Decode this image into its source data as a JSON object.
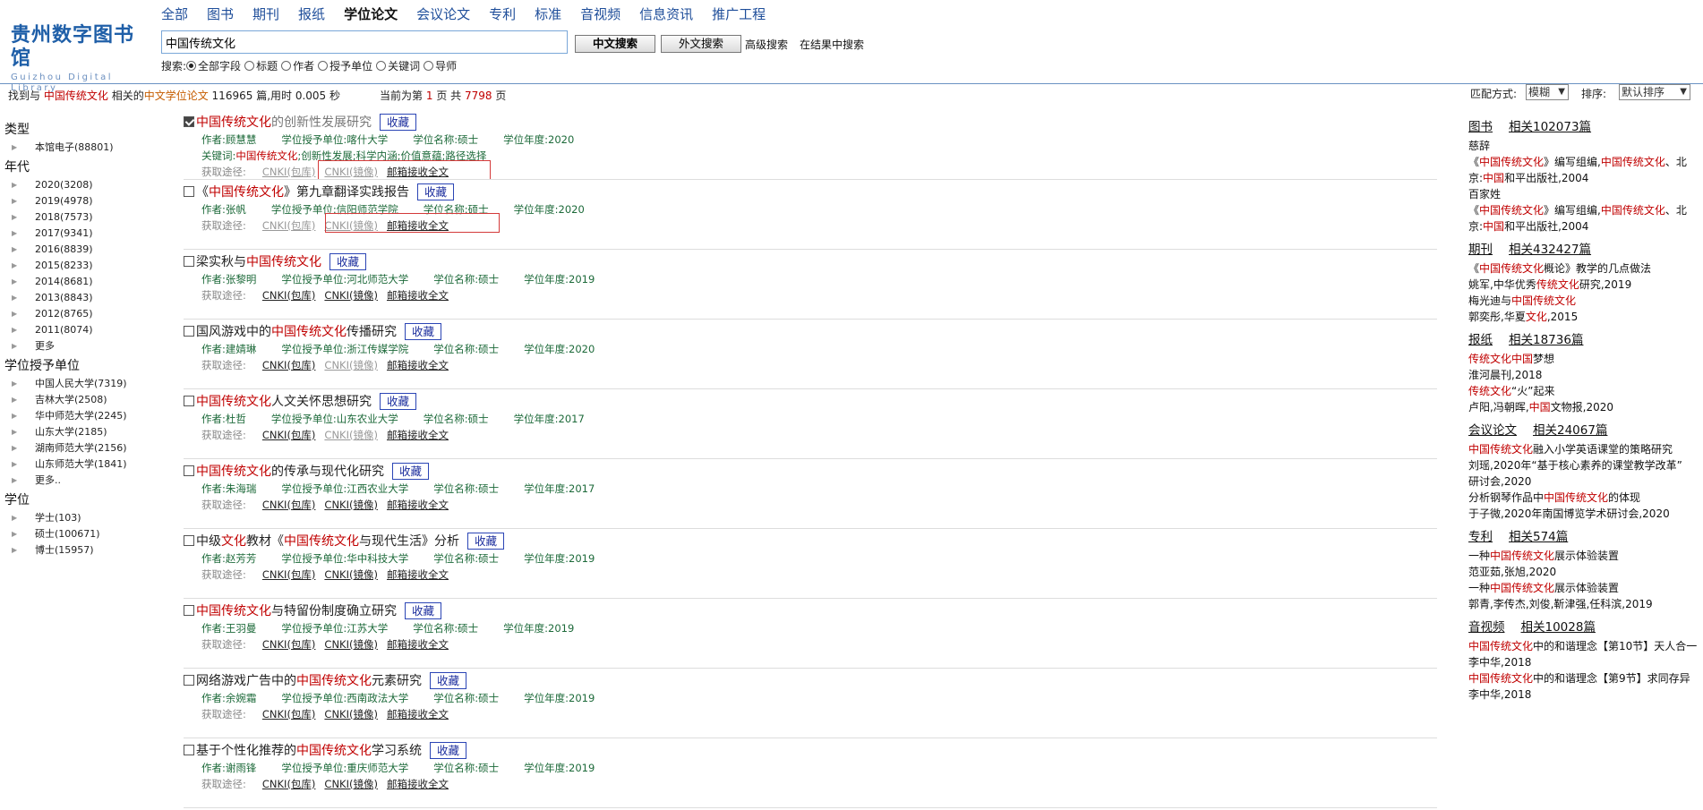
{
  "logo": {
    "cn": "贵州数字图书馆",
    "en": "Guizhou Digital Library"
  },
  "nav": [
    "全部",
    "图书",
    "期刊",
    "报纸",
    "学位论文",
    "会议论文",
    "专利",
    "标准",
    "音视频",
    "信息资讯",
    "推广工程"
  ],
  "nav_active": 4,
  "search": {
    "value": "中国传统文化",
    "btn_cn": "中文搜索",
    "btn_foreign": "外文搜索",
    "advanced": "高级搜索",
    "within": "在结果中搜索"
  },
  "scope": {
    "label": "搜索:",
    "options": [
      "全部字段",
      "标题",
      "作者",
      "授予单位",
      "关键词",
      "导师"
    ],
    "selected": 0
  },
  "summary": {
    "found_prefix": "找到与",
    "query": "中国传统文化",
    "related_prefix": "相关的",
    "type": "中文学位论文",
    "count": "116965",
    "time_text": "篇,用时 0.005 秒"
  },
  "paging": {
    "prefix": "当前为第",
    "current": "1",
    "middle": "页 共",
    "total": "7798",
    "suffix": "页"
  },
  "match": {
    "label": "匹配方式:",
    "value": "模糊"
  },
  "sort": {
    "label": "排序:",
    "value": "默认排序"
  },
  "facets": {
    "type": {
      "title": "类型",
      "items": [
        "本馆电子(88801)"
      ]
    },
    "year": {
      "title": "年代",
      "items": [
        "2020(3208)",
        "2019(4978)",
        "2018(7573)",
        "2017(9341)",
        "2016(8839)",
        "2015(8233)",
        "2014(8681)",
        "2013(8843)",
        "2012(8765)",
        "2011(8074)",
        "更多"
      ]
    },
    "unit": {
      "title": "学位授予单位",
      "items": [
        "中国人民大学(7319)",
        "吉林大学(2508)",
        "华中师范大学(2245)",
        "山东大学(2185)",
        "湖南师范大学(2156)",
        "山东师范大学(1841)",
        "更多.."
      ]
    },
    "degree": {
      "title": "学位",
      "items": [
        "学士(103)",
        "硕士(100671)",
        "博士(15957)"
      ]
    }
  },
  "labels": {
    "author": "作者:",
    "unit": "学位授予单位:",
    "degree": "学位名称:",
    "year": "学位年度:",
    "keywords": "关键词:",
    "access": "获取途径:",
    "collect": "收藏",
    "acc1": "CNKI(包库)",
    "acc2": "CNKI(镜像)",
    "acc3": "邮箱接收全文"
  },
  "results": [
    {
      "title": [
        "中国传统文化",
        "的创新性发展研究"
      ],
      "author": "顾慧慧",
      "unit": "喀什大学",
      "degree": "硕士",
      "year": "2020",
      "keywords": [
        "中国传统文化",
        "创新性发展",
        "科学内涵",
        "价值意蕴",
        "路径选择"
      ]
    },
    {
      "title": [
        "《",
        "中国传统文化",
        "》第九章翻译实践报告"
      ],
      "author": "张帆",
      "unit": "信阳师范学院",
      "degree": "硕士",
      "year": "2020"
    },
    {
      "title": [
        "梁实秋与",
        "中国传统文化"
      ],
      "author": "张黎明",
      "unit": "河北师范大学",
      "degree": "硕士",
      "year": "2019"
    },
    {
      "title": [
        "国风游戏中的",
        "中国传统文化",
        "传播研究"
      ],
      "author": "建婧琳",
      "unit": "浙江传媒学院",
      "degree": "硕士",
      "year": "2020"
    },
    {
      "title": [
        "中国传统文化",
        "人文关怀思想研究"
      ],
      "author": "杜哲",
      "unit": "山东农业大学",
      "degree": "硕士",
      "year": "2017"
    },
    {
      "title": [
        "中国传统文化",
        "的传承与现代化研究"
      ],
      "author": "朱海瑞",
      "unit": "江西农业大学",
      "degree": "硕士",
      "year": "2017"
    },
    {
      "title": [
        "中级",
        "文化",
        "教材《",
        "中国传统文化",
        "与现代生活》分析"
      ],
      "author": "赵芳芳",
      "unit": "华中科技大学",
      "degree": "硕士",
      "year": "2019"
    },
    {
      "title": [
        "中国传统文化",
        "与特留份制度确立研究"
      ],
      "author": "王羽曼",
      "unit": "江苏大学",
      "degree": "硕士",
      "year": "2019"
    },
    {
      "title": [
        "网络游戏广告中的",
        "中国传统文化",
        "元素研究"
      ],
      "author": "余婉霜",
      "unit": "西南政法大学",
      "degree": "硕士",
      "year": "2019"
    },
    {
      "title": [
        "基于个性化推荐的",
        "中国传统文化",
        "学习系统"
      ],
      "author": "谢雨锋",
      "unit": "重庆师范大学",
      "degree": "硕士",
      "year": "2019"
    }
  ],
  "right": [
    {
      "cat": "图书",
      "count": "相关102073篇",
      "lines": [
        [
          [
            "慈辞",
            0
          ]
        ],
        [
          [
            "《",
            0
          ],
          [
            "中国传统文化",
            1
          ],
          [
            "》编写组编,",
            0
          ],
          [
            "中国传统文化",
            1
          ],
          [
            "、北",
            0
          ]
        ],
        [
          [
            "京:",
            0
          ],
          [
            "中国",
            1
          ],
          [
            "和平出版社,2004",
            0
          ]
        ],
        [
          [
            "百家姓",
            0
          ]
        ],
        [
          [
            "《",
            0
          ],
          [
            "中国传统文化",
            1
          ],
          [
            "》编写组编,",
            0
          ],
          [
            "中国传统文化",
            1
          ],
          [
            "、北",
            0
          ]
        ],
        [
          [
            "京:",
            0
          ],
          [
            "中国",
            1
          ],
          [
            "和平出版社,2004",
            0
          ]
        ]
      ]
    },
    {
      "cat": "期刊",
      "count": "相关432427篇",
      "lines": [
        [
          [
            "《",
            0
          ],
          [
            "中国传统文化",
            1
          ],
          [
            "概论》教学的几点做法",
            0
          ]
        ],
        [
          [
            "姚军,中华优秀",
            0
          ],
          [
            "传统文化",
            1
          ],
          [
            "研究,2019",
            0
          ]
        ],
        [
          [
            "梅光迪与",
            0
          ],
          [
            "中国传统文化",
            1
          ]
        ],
        [
          [
            "郭奕彤,华夏",
            0
          ],
          [
            "文化",
            1
          ],
          [
            ",2015",
            0
          ]
        ]
      ]
    },
    {
      "cat": "报纸",
      "count": "相关18736篇",
      "lines": [
        [
          [
            "传统文化",
            1
          ],
          [
            "中国",
            1
          ],
          [
            "梦想",
            0
          ]
        ],
        [
          [
            "淮河晨刊,2018",
            0
          ]
        ],
        [
          [
            "传统文化",
            1
          ],
          [
            "“火”起来",
            0
          ]
        ],
        [
          [
            "卢阳,冯朝晖,",
            0
          ],
          [
            "中国",
            1
          ],
          [
            "文物报,2020",
            0
          ]
        ]
      ]
    },
    {
      "cat": "会议论文",
      "count": "相关24067篇",
      "lines": [
        [
          [
            "中国传统文化",
            1
          ],
          [
            "融入小学英语课堂的策略研究",
            0
          ]
        ],
        [
          [
            "刘瑶,2020年“基于核心素养的课堂教学改革”",
            0
          ]
        ],
        [
          [
            "研讨会,2020",
            0
          ]
        ],
        [
          [
            "分析钢琴作品中",
            0
          ],
          [
            "中国传统文化",
            1
          ],
          [
            "的体现",
            0
          ]
        ],
        [
          [
            "于子微,2020年南国博览学术研讨会,2020",
            0
          ]
        ]
      ]
    },
    {
      "cat": "专利",
      "count": "相关574篇",
      "lines": [
        [
          [
            "一种",
            0
          ],
          [
            "中国传统文化",
            1
          ],
          [
            "展示体验装置",
            0
          ]
        ],
        [
          [
            "范亚茹,张旭,2020",
            0
          ]
        ],
        [
          [
            "一种",
            0
          ],
          [
            "中国传统文化",
            1
          ],
          [
            "展示体验装置",
            0
          ]
        ],
        [
          [
            "郭青,李传杰,刘俊,靳津强,任科滨,2019",
            0
          ]
        ]
      ]
    },
    {
      "cat": "音视频",
      "count": "相关10028篇",
      "lines": [
        [
          [
            "中国传统文化",
            1
          ],
          [
            "中的和谐理念【第10节】天人合一",
            0
          ]
        ],
        [
          [
            "李中华,2018",
            0
          ]
        ],
        [
          [
            "中国传统文化",
            1
          ],
          [
            "中的和谐理念【第9节】求同存异",
            0
          ]
        ],
        [
          [
            "李中华,2018",
            0
          ]
        ]
      ]
    }
  ]
}
